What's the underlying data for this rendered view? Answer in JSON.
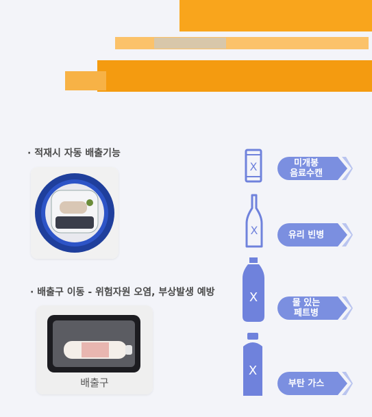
{
  "features": {
    "auto_eject_label": "· 적재시 자동 배출기능",
    "outlet_move_label": "· 배출구 이동 - 위험자원 오염, 부상발생 예방",
    "outlet_caption": "배출구"
  },
  "rejected_items": [
    {
      "icon": "can-icon",
      "mark": "X",
      "label_line1": "미개봉",
      "label_line2": "음료수캔"
    },
    {
      "icon": "glass-bottle-icon",
      "mark": "X",
      "label_line1": "유리 빈병",
      "label_line2": ""
    },
    {
      "icon": "pet-bottle-icon",
      "mark": "X",
      "label_line1": "물 있는",
      "label_line2": "페트병"
    },
    {
      "icon": "gas-can-icon",
      "mark": "X",
      "label_line1": "부탄 가스",
      "label_line2": ""
    }
  ],
  "colors": {
    "banner_orange": "#f8a21b",
    "banner_light": "#fbc46c",
    "pill_blue": "#7b8fe0",
    "icon_blue": "#6f82dc",
    "text_gray": "#4a4a4a"
  }
}
